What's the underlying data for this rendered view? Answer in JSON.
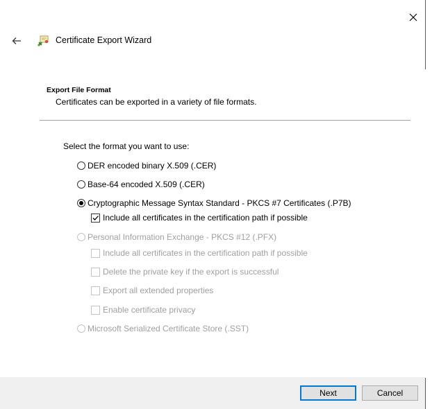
{
  "wizard": {
    "title": "Certificate Export Wizard"
  },
  "page": {
    "heading": "Export File Format",
    "description": "Certificates can be exported in a variety of file formats.",
    "prompt": "Select the format you want to use:"
  },
  "formats": [
    {
      "label": "DER encoded binary X.509 (.CER)",
      "selected": false,
      "enabled": true
    },
    {
      "label": "Base-64 encoded X.509 (.CER)",
      "selected": false,
      "enabled": true
    },
    {
      "label": "Cryptographic Message Syntax Standard - PKCS #7 Certificates (.P7B)",
      "selected": true,
      "enabled": true
    },
    {
      "label": "Personal Information Exchange - PKCS #12 (.PFX)",
      "selected": false,
      "enabled": false
    },
    {
      "label": "Microsoft Serialized Certificate Store (.SST)",
      "selected": false,
      "enabled": false
    }
  ],
  "p7b_options": {
    "include_path": {
      "label": "Include all certificates in the certification path if possible",
      "checked": true,
      "enabled": true
    }
  },
  "pfx_options": {
    "include_path": {
      "label": "Include all certificates in the certification path if possible",
      "checked": false,
      "enabled": false
    },
    "delete_key": {
      "label": "Delete the private key if the export is successful",
      "checked": false,
      "enabled": false
    },
    "export_ext": {
      "label": "Export all extended properties",
      "checked": false,
      "enabled": false
    },
    "privacy": {
      "label": "Enable certificate privacy",
      "checked": false,
      "enabled": false
    }
  },
  "buttons": {
    "next": "Next",
    "cancel": "Cancel"
  },
  "icons": {
    "close": "close-icon",
    "back": "back-arrow-icon",
    "wizard": "certificate-wizard-icon"
  },
  "colors": {
    "accent": "#0078d7",
    "footer": "#f0f0f0",
    "disabled_text": "#a0a0a0"
  }
}
